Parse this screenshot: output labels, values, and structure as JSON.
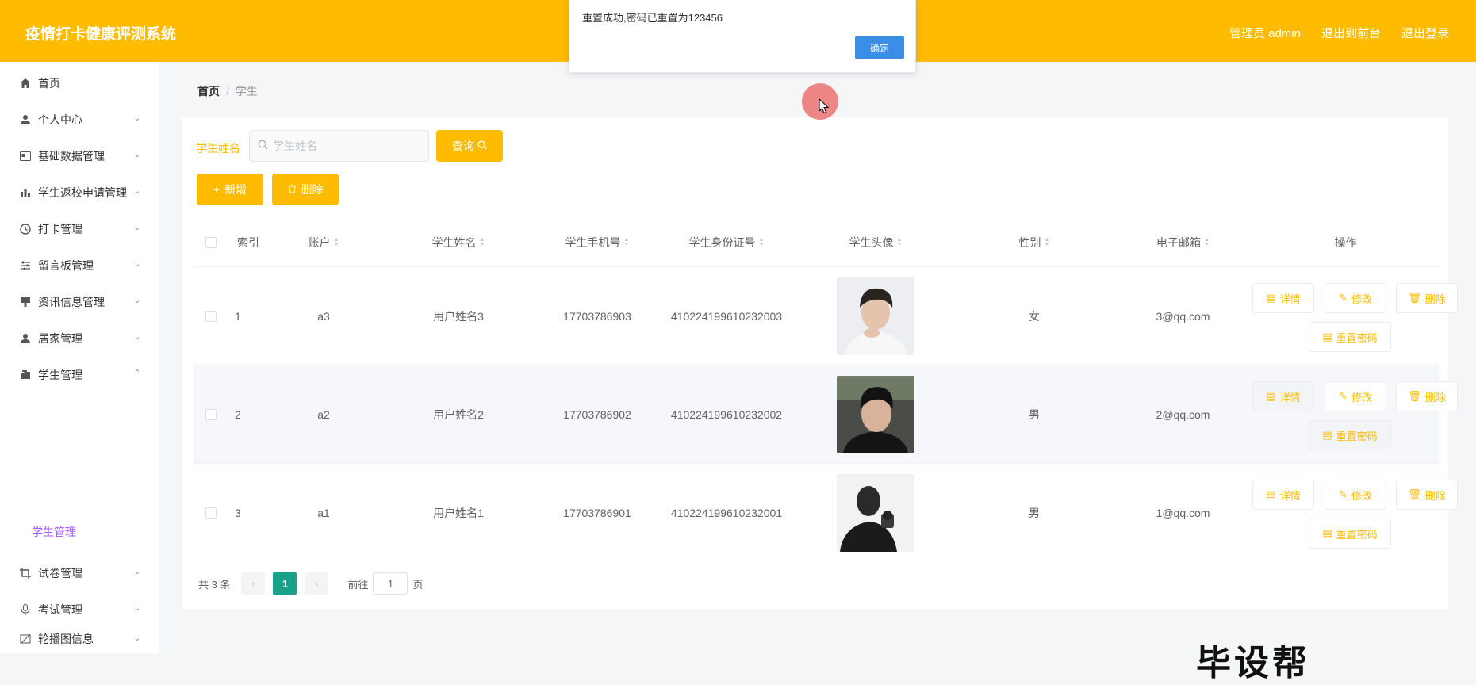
{
  "app": {
    "title": "疫情打卡健康评测系统",
    "user_label": "管理员 admin",
    "to_front": "退出到前台",
    "logout": "退出登录"
  },
  "dialog": {
    "message": "重置成功,密码已重置为123456",
    "ok": "确定"
  },
  "sidebar": {
    "items": [
      {
        "label": "首页",
        "icon": "home-icon"
      },
      {
        "label": "个人中心",
        "icon": "user-icon"
      },
      {
        "label": "基础数据管理",
        "icon": "id-card-icon"
      },
      {
        "label": "学生返校申请管理",
        "icon": "bar-chart-icon"
      },
      {
        "label": "打卡管理",
        "icon": "clock-icon"
      },
      {
        "label": "留言板管理",
        "icon": "sliders-icon"
      },
      {
        "label": "资讯信息管理",
        "icon": "info-icon"
      },
      {
        "label": "居家管理",
        "icon": "user-icon"
      },
      {
        "label": "学生管理",
        "icon": "folder-icon"
      },
      {
        "label": "试卷管理",
        "icon": "crop-icon"
      },
      {
        "label": "考试管理",
        "icon": "mic-icon"
      },
      {
        "label": "轮播图信息",
        "icon": "slash-icon"
      }
    ],
    "sub_active": "学生管理"
  },
  "breadcrumb": {
    "home": "首页",
    "current": "学生"
  },
  "search": {
    "label": "学生姓名",
    "placeholder": "学生姓名",
    "query_button": "查询"
  },
  "actions": {
    "add": "新增",
    "delete": "删除"
  },
  "table": {
    "headers": [
      "索引",
      "账户",
      "学生姓名",
      "学生手机号",
      "学生身份证号",
      "学生头像",
      "性别",
      "电子邮箱",
      "操作"
    ],
    "rows": [
      {
        "index": "1",
        "account": "a3",
        "name": "用户姓名3",
        "phone": "17703786903",
        "idcard": "410224199610232003",
        "gender": "女",
        "email": "3@qq.com"
      },
      {
        "index": "2",
        "account": "a2",
        "name": "用户姓名2",
        "phone": "17703786902",
        "idcard": "410224199610232002",
        "gender": "男",
        "email": "2@qq.com"
      },
      {
        "index": "3",
        "account": "a1",
        "name": "用户姓名1",
        "phone": "17703786901",
        "idcard": "410224199610232001",
        "gender": "男",
        "email": "1@qq.com"
      }
    ],
    "ops": {
      "detail": "详情",
      "edit": "修改",
      "delete": "删除",
      "reset": "重置密码"
    }
  },
  "pagination": {
    "total": "共 3 条",
    "current": "1",
    "goto": "前往",
    "page_value": "1",
    "page_unit": "页"
  },
  "watermark": "毕设帮"
}
